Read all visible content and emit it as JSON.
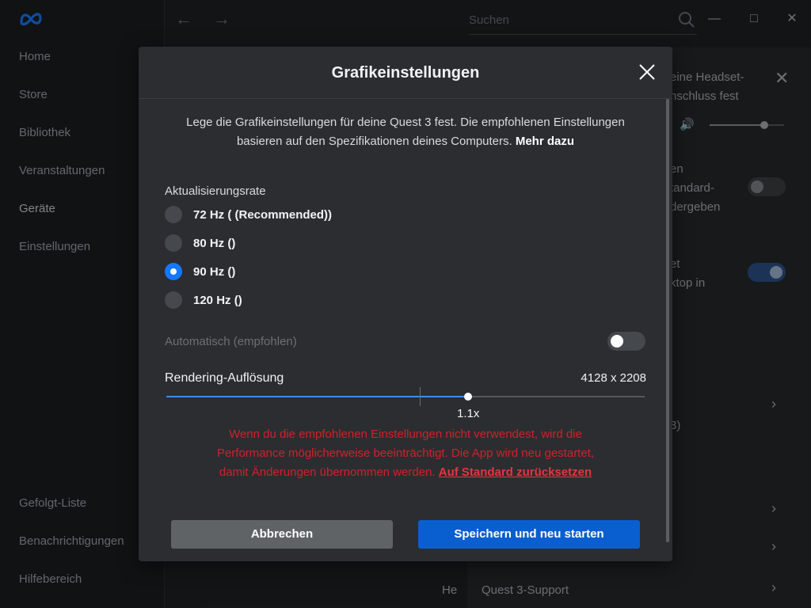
{
  "sidebar": {
    "nav": [
      "Home",
      "Store",
      "Bibliothek",
      "Veranstaltungen",
      "Geräte",
      "Einstellungen"
    ],
    "nav_bottom": [
      "Gefolgt-Liste",
      "Benachrichtigungen",
      "Hilfebereich"
    ]
  },
  "topbar": {
    "search_placeholder": "Suchen"
  },
  "background_panel": {
    "line1": "eine Headset-",
    "line2": "nschluss fest",
    "line3": "en",
    "line4": "tandard-",
    "line5": "dergeben",
    "line6": "et",
    "line7": "ktop in",
    "line8": "3)",
    "support_label": "Quest 3-Support",
    "he_label": "He"
  },
  "dialog": {
    "title": "Grafikeinstellungen",
    "intro": "Lege die Grafikeinstellungen für deine Quest 3 fest. Die empfohlenen Einstellungen basieren auf den Spezifikationen deines Computers.",
    "intro_link": "Mehr dazu",
    "refresh_label": "Aktualisierungsrate",
    "refresh_options": [
      {
        "label": "72 Hz ( (Recommended))",
        "selected": false
      },
      {
        "label": "80 Hz ()",
        "selected": false
      },
      {
        "label": "90 Hz ()",
        "selected": true
      },
      {
        "label": "120 Hz ()",
        "selected": false
      }
    ],
    "auto_label": "Automatisch (empfohlen)",
    "auto_enabled": false,
    "resolution_label": "Rendering-Auflösung",
    "resolution_value": "4128 x 2208",
    "slider": {
      "value_label": "1.1x",
      "fraction": 0.63,
      "default_fraction": 0.53
    },
    "warning": "Wenn du die empfohlenen Einstellungen nicht verwendest, wird die Performance möglicherweise beeinträchtigt. Die App wird neu gestartet, damit Änderungen übernommen werden.",
    "reset_link": "Auf Standard zurücksetzen",
    "cancel_label": "Abbrechen",
    "save_label": "Speichern und neu starten"
  },
  "colors": {
    "accent": "#1677ff",
    "save_button": "#0a5fd0",
    "warning": "#d2202a"
  }
}
